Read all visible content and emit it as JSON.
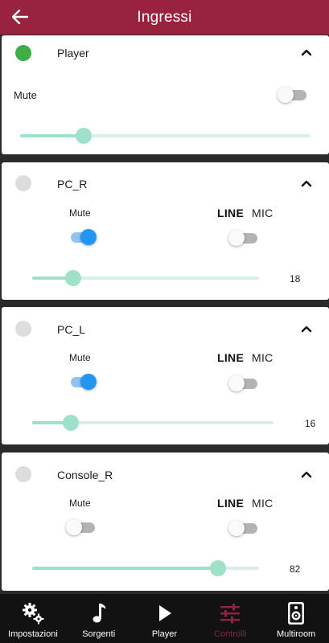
{
  "header": {
    "title": "Ingressi"
  },
  "cards": [
    {
      "name": "Player",
      "status_color": "#3fae49",
      "mute_label": "Mute",
      "mute_on": false,
      "level": 0.22
    },
    {
      "name": "PC_R",
      "status_color": "#dddddd",
      "mute_label": "Mute",
      "mute_on": true,
      "line_label": "LINE",
      "mic_label": "MIC",
      "mic_on": false,
      "value": "18",
      "level": 0.18
    },
    {
      "name": "PC_L",
      "status_color": "#dddddd",
      "mute_label": "Mute",
      "mute_on": true,
      "line_label": "LINE",
      "mic_label": "MIC",
      "mic_on": false,
      "value": "16",
      "level": 0.16
    },
    {
      "name": "Console_R",
      "status_color": "#dddddd",
      "mute_label": "Mute",
      "mute_on": false,
      "line_label": "LINE",
      "mic_label": "MIC",
      "mic_on": false,
      "value": "82",
      "level": 0.82
    }
  ],
  "nav": {
    "items": [
      {
        "label": "Impostazioni",
        "icon": "gears-icon"
      },
      {
        "label": "Sorgenti",
        "icon": "music-note-icon"
      },
      {
        "label": "Player",
        "icon": "play-icon"
      },
      {
        "label": "Controlli",
        "icon": "sliders-icon",
        "active": true
      },
      {
        "label": "Multiroom",
        "icon": "speaker-icon"
      }
    ],
    "active_color": "#8a2440"
  }
}
